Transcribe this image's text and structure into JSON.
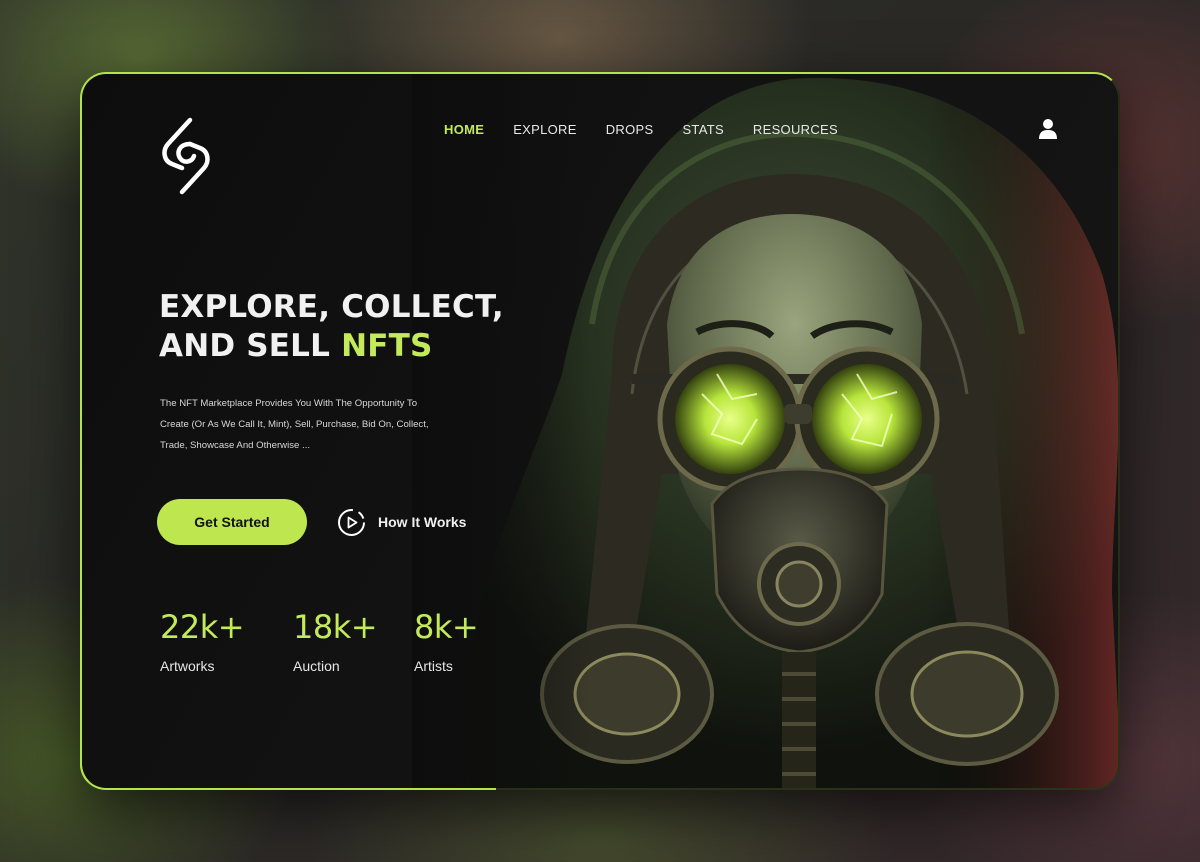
{
  "nav": {
    "items": [
      {
        "label": "HOME",
        "active": true
      },
      {
        "label": "EXPLORE",
        "active": false
      },
      {
        "label": "DROPS",
        "active": false
      },
      {
        "label": "STATS",
        "active": false
      },
      {
        "label": "RESOURCES",
        "active": false
      }
    ]
  },
  "hero": {
    "headline_line1": "EXPLORE, COLLECT,",
    "headline_line2_prefix": "AND SELL ",
    "headline_line2_accent": "NFTS",
    "description": "The NFT Marketplace Provides You With The Opportunity To Create (Or As We Call It, Mint), Sell, Purchase, Bid On, Collect, Trade, Showcase And Otherwise ..."
  },
  "actions": {
    "primary_label": "Get Started",
    "secondary_label": "How It Works"
  },
  "stats": [
    {
      "value": "22k+",
      "label": "Artworks"
    },
    {
      "value": "18k+",
      "label": "Auction"
    },
    {
      "value": "8k+",
      "label": "Artists"
    }
  ],
  "colors": {
    "accent": "#c3ea5a",
    "button": "#bde64f",
    "background": "#0d0d0d",
    "text": "#f1f1f1"
  },
  "icons": {
    "logo": "brand-logo-icon",
    "user": "user-icon",
    "play": "play-circle-icon"
  }
}
